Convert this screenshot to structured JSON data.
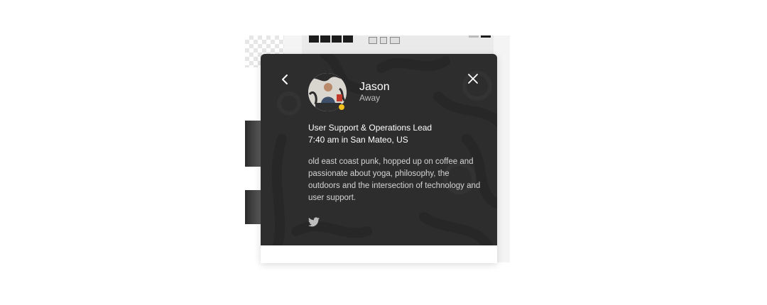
{
  "profile": {
    "name": "Jason",
    "presence": "Away",
    "title": "User Support & Operations Lead",
    "local_time": "7:40 am in San Mateo, US",
    "bio": "old east coast punk, hopped up on coffee and passionate about yoga, philosophy, the outdoors and the intersection of technology and user support."
  },
  "icons": {
    "back": "chevron-left-icon",
    "close": "close-icon",
    "social": "twitter-icon",
    "status": "away-status-dot"
  },
  "colors": {
    "card_bg": "#2d2d2d",
    "away_status": "#f2c21b",
    "text_primary": "#ffffff",
    "text_secondary": "#bdbdbd"
  }
}
